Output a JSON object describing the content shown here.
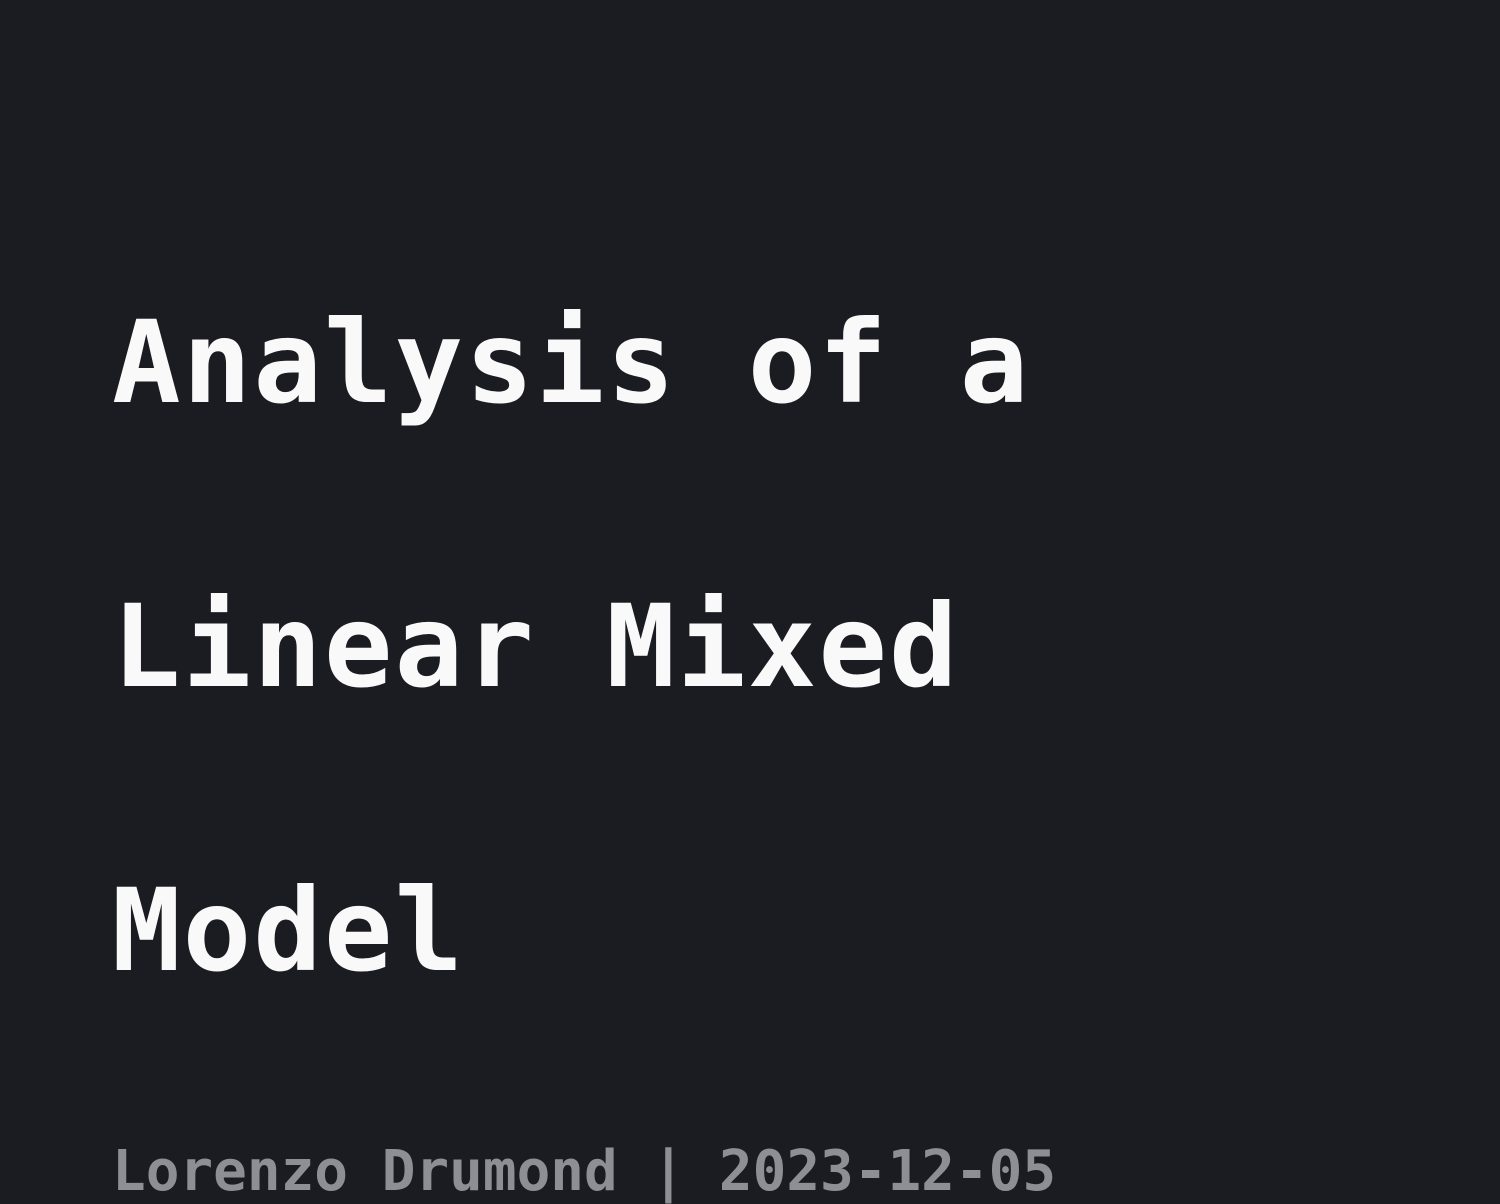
{
  "title_lines": [
    "Analysis of a",
    "Linear Mixed",
    "Model"
  ],
  "byline": {
    "author": "Lorenzo Drumond",
    "separator": "|",
    "date": "2023-12-05"
  },
  "colors": {
    "background": "#1b1c21",
    "title": "#f9f9f9",
    "byline": "#8e8f94"
  }
}
